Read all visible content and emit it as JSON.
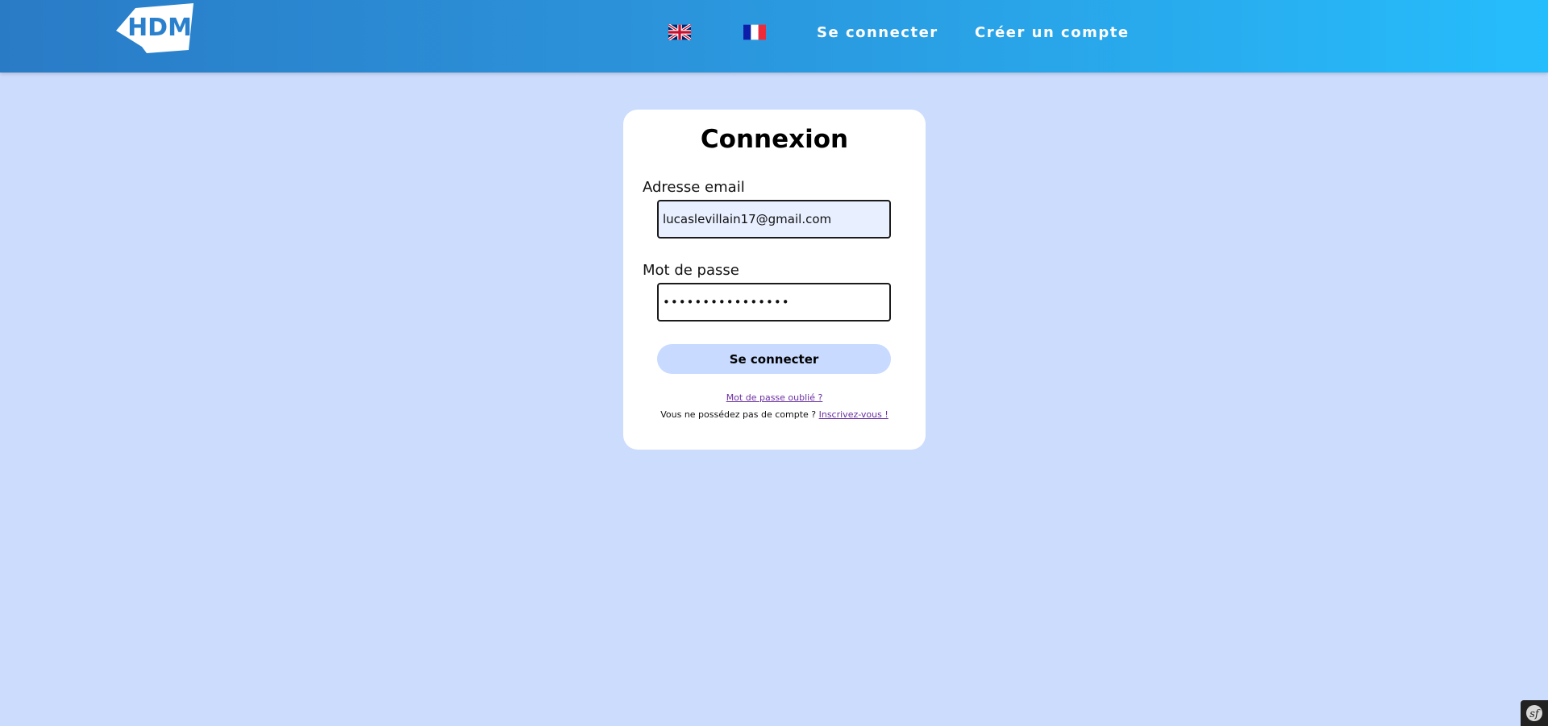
{
  "header": {
    "logo_text": "HDM",
    "languages": [
      {
        "code": "en",
        "icon": "uk-flag-icon"
      },
      {
        "code": "fr",
        "icon": "france-flag-icon"
      }
    ],
    "nav": {
      "login_label": "Se connecter",
      "register_label": "Créer un compte"
    }
  },
  "login_form": {
    "title": "Connexion",
    "email_label": "Adresse email",
    "email_value": "lucaslevillain17@gmail.com",
    "password_label": "Mot de passe",
    "password_value": "••••••••••••••••",
    "submit_label": "Se connecter",
    "forgot_label": "Mot de passe oublié ?",
    "no_account_text": "Vous ne possédez pas de compte ?",
    "signup_label": "Inscrivez-vous !"
  },
  "colors": {
    "background": "#ccdcfd",
    "header_start": "#2a7bc6",
    "header_end": "#26bdfc",
    "button": "#c8daff",
    "link": "#6b2fa0"
  },
  "debug_toolbar": {
    "icon": "symfony-icon"
  }
}
